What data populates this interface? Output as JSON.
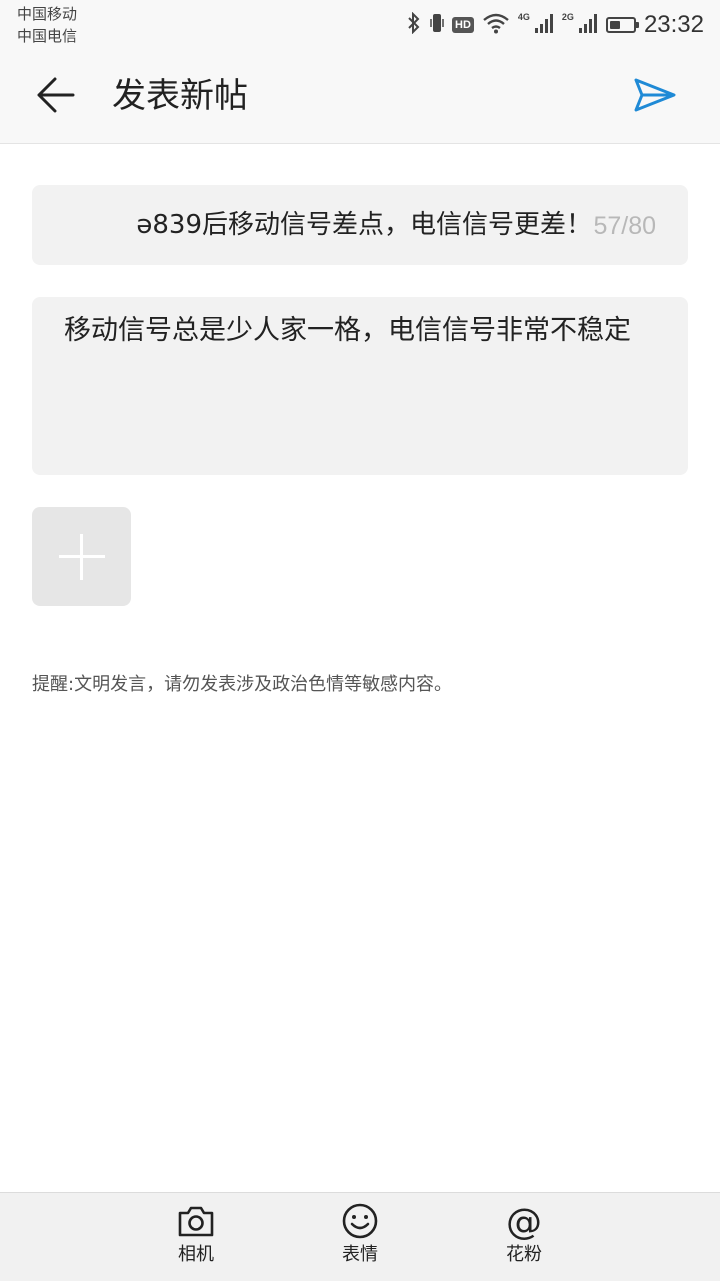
{
  "status_bar": {
    "carrier_1": "中国移动",
    "carrier_2": "中国电信",
    "hd_badge": "HD",
    "net_1": "4G",
    "net_2": "2G",
    "battery_level": 0.45,
    "time": "23:32"
  },
  "header": {
    "title": "发表新帖",
    "back_icon": "arrow-left-icon",
    "send_icon": "paper-plane-icon",
    "accent_color": "#1f8ad6"
  },
  "post_title": {
    "value": "ǝ839后移动信号差点，电信信号更差！",
    "counter": "57/80"
  },
  "post_body": {
    "value": "移动信号总是少人家一格，电信信号非常不稳定"
  },
  "reminder": "提醒:文明发言，请勿发表涉及政治色情等敏感内容。",
  "toolbar": {
    "camera_label": "相机",
    "emoji_label": "表情",
    "fans_label": "花粉",
    "at_symbol": "@"
  }
}
